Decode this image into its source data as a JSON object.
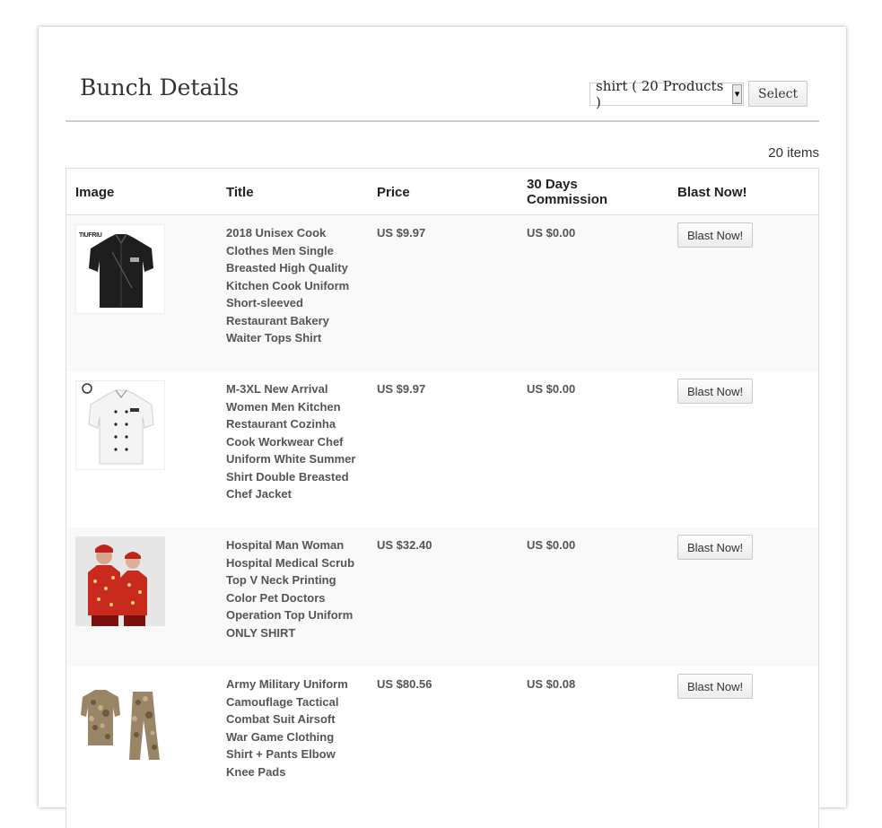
{
  "header": {
    "title": "Bunch Details",
    "select_value": "shirt ( 20 Products )",
    "select_button": "Select"
  },
  "item_count": "20 items",
  "table": {
    "columns": [
      "Image",
      "Title",
      "Price",
      "30 Days Commission",
      "Blast Now!"
    ],
    "rows": [
      {
        "brand": "TIUFRIU",
        "image": "black-chef-shirt",
        "title": "2018 Unisex Cook Clothes Men Single Breasted High Quality Kitchen Cook Uniform Short-sleeved Restaurant Bakery Waiter Tops Shirt",
        "price": "US $9.97",
        "commission": "US $0.00",
        "button": "Blast Now!"
      },
      {
        "brand": "",
        "image": "white-chef-jacket",
        "title": "M-3XL New Arrival Women Men Kitchen Restaurant Cozinha Cook Workwear Chef Uniform White Summer Shirt Double Breasted Chef Jacket",
        "price": "US $9.97",
        "commission": "US $0.00",
        "button": "Blast Now!"
      },
      {
        "brand": "",
        "image": "red-scrub-couple",
        "title": "Hospital Man Woman Hospital Medical Scrub Top V Neck Printing Color Pet Doctors Operation Top Uniform ONLY SHIRT",
        "price": "US $32.40",
        "commission": "US $0.00",
        "button": "Blast Now!"
      },
      {
        "brand": "",
        "image": "camouflage-uniform",
        "title": "Army Military Uniform Camouflage Tactical Combat Suit Airsoft War Game Clothing Shirt + Pants Elbow Knee Pads",
        "price": "US $80.56",
        "commission": "US $0.08",
        "button": "Blast Now!"
      }
    ]
  }
}
